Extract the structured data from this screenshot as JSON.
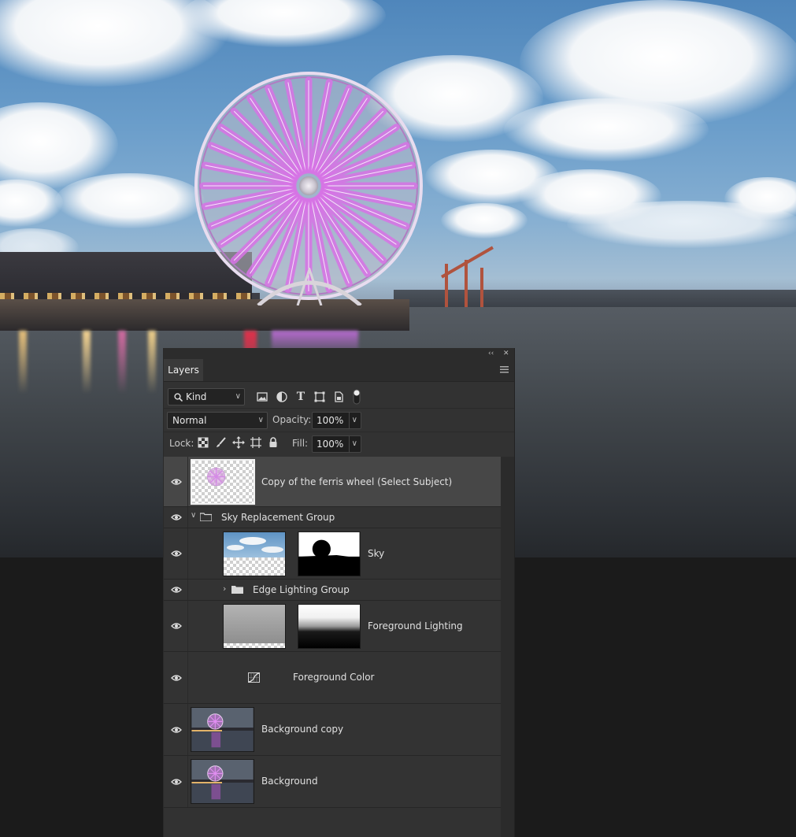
{
  "panel": {
    "tab": "Layers",
    "filter": {
      "kind": "Kind"
    },
    "blend_mode": "Normal",
    "opacity_label": "Opacity:",
    "opacity_value": "100%",
    "lock_label": "Lock:",
    "fill_label": "Fill:",
    "fill_value": "100%"
  },
  "layers": [
    {
      "name": "Copy of the ferris wheel (Select Subject)",
      "visible": true,
      "selected": true
    },
    {
      "name": "Sky Replacement Group",
      "visible": true,
      "type": "group",
      "expanded": true
    },
    {
      "name": "Sky",
      "visible": true,
      "has_mask": true
    },
    {
      "name": "Edge Lighting Group",
      "visible": true,
      "type": "group",
      "expanded": false
    },
    {
      "name": "Foreground Lighting",
      "visible": true,
      "has_mask": true
    },
    {
      "name": "Foreground Color",
      "visible": true,
      "type": "adjustment"
    },
    {
      "name": "Background copy",
      "visible": true
    },
    {
      "name": "Background",
      "visible": true
    }
  ],
  "colors": {
    "wheel_glow": "#d873e6",
    "panel_bg": "#323232",
    "selected_row": "#474747"
  }
}
